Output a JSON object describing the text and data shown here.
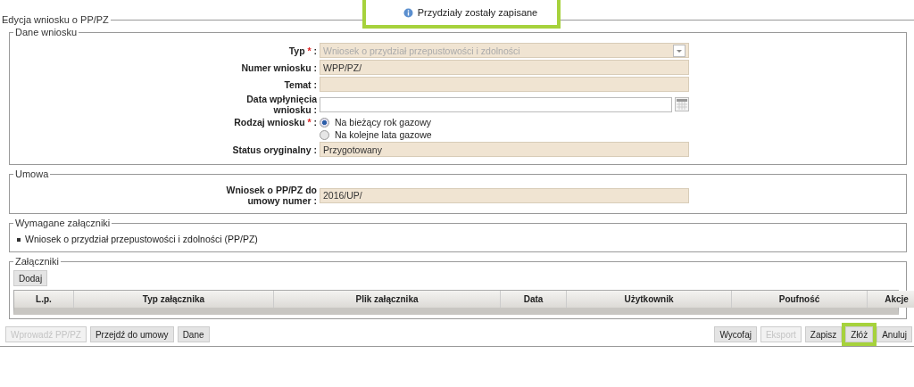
{
  "notification": {
    "text": "Przydziały zostały zapisane",
    "highlighted": true
  },
  "form": {
    "title": "Edycja wniosku o PP/PZ",
    "sections": [
      {
        "kind": "fields",
        "title": "Dane wniosku",
        "fields": [
          {
            "kind": "select",
            "label": "Typ",
            "required_mark": "*",
            "colon": ":",
            "value": "Wniosek o przydział przepustowości i zdolności",
            "disabled": true
          },
          {
            "kind": "text",
            "label": "Numer wniosku",
            "colon": ":",
            "value": "WPP/PZ/",
            "disabled": true
          },
          {
            "kind": "text",
            "label": "Temat",
            "colon": ":",
            "disabled": true
          },
          {
            "kind": "date",
            "label": "Data wpłynięcia wniosku",
            "colon": ":",
            "disabled": false
          },
          {
            "kind": "radio",
            "label": "Rodzaj wniosku",
            "required_mark": "*",
            "colon": ":",
            "options": [
              {
                "label": "Na bieżący rok gazowy",
                "selected": true
              },
              {
                "label": "Na kolejne lata gazowe",
                "selected": false
              }
            ]
          },
          {
            "kind": "text",
            "label": "Status oryginalny",
            "colon": ":",
            "value": "Przygotowany",
            "disabled": true
          }
        ]
      },
      {
        "kind": "fields",
        "title": "Umowa",
        "fields": [
          {
            "kind": "text",
            "label": "Wniosek o PP/PZ do umowy numer",
            "colon": ":",
            "value": "2016/UP/",
            "disabled": true
          }
        ]
      },
      {
        "kind": "list",
        "title": "Wymagane załączniki",
        "items": [
          "Wniosek o przydział przepustowości i zdolności (PP/PZ)"
        ]
      },
      {
        "kind": "table",
        "title": "Załączniki",
        "add_button": "Dodaj",
        "columns": [
          "L.p.",
          "Typ załącznika",
          "Plik załącznika",
          "Data",
          "Użytkownik",
          "Poufność",
          "Akcje"
        ]
      }
    ],
    "left_buttons": [
      {
        "label": "Wprowadź PP/PZ",
        "disabled": true,
        "highlighted": false
      },
      {
        "label": "Przejdź do umowy",
        "disabled": false,
        "highlighted": false
      },
      {
        "label": "Dane",
        "disabled": false,
        "highlighted": false
      }
    ],
    "right_buttons": [
      {
        "label": "Wycofaj",
        "disabled": false,
        "highlighted": false
      },
      {
        "label": "Eksport",
        "disabled": true,
        "highlighted": false
      },
      {
        "label": "Zapisz",
        "disabled": false,
        "highlighted": false
      },
      {
        "label": "Złóż",
        "disabled": false,
        "highlighted": true
      },
      {
        "label": "Anuluj",
        "disabled": false,
        "highlighted": false
      }
    ]
  }
}
